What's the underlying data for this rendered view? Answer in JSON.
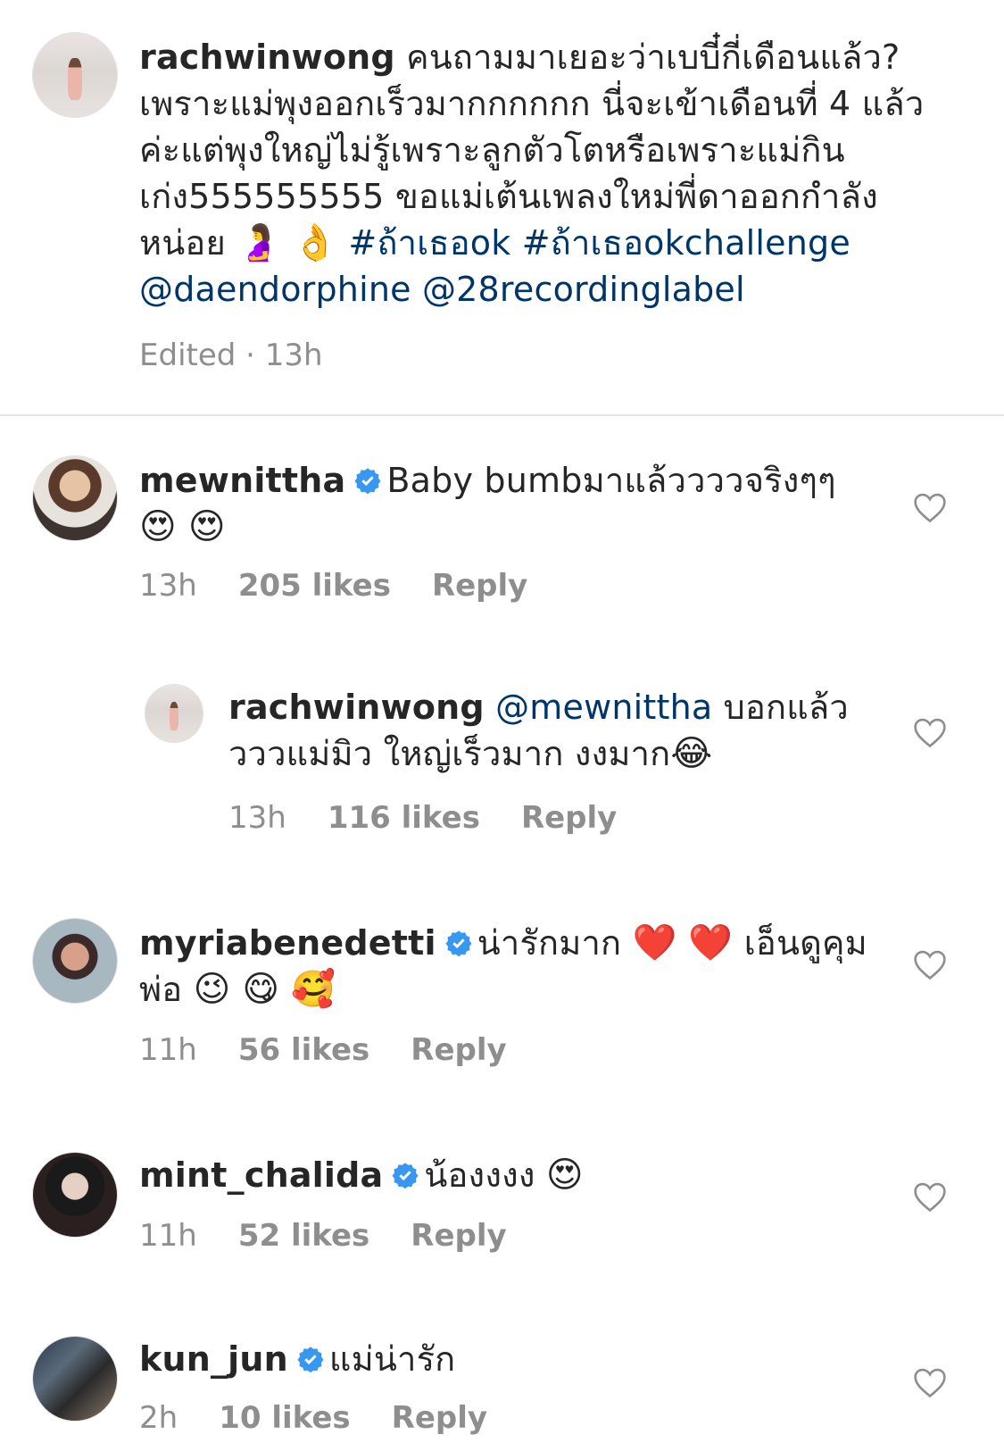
{
  "caption": {
    "username": "rachwinwong",
    "text": "คนถามมาเยอะว่าเบบี๋กี่เดือนแล้ว? เพราะแม่พุงออกเร็วมากกกกกก นี่จะเข้าเดือนที่ 4 แล้วค่ะแต่พุงใหญ่ไม่รู้เพราะลูกตัวโตหรือเพราะแม่กินเก่ง555555555 ขอแม่เต้นเพลงใหม่พี่ดาออกกำลังหน่อย",
    "emoji": "🤰 👌",
    "hashtags": "#ถ้าเธอok #ถ้าเธอokchallenge",
    "mentions": "@daendorphine @28recordinglabel",
    "edited": "Edited · 13h"
  },
  "comments": [
    {
      "username": "mewnittha",
      "text": "Baby bumbมาแล้ววววจริงๆๆ",
      "emoji": "😍 😍",
      "time": "13h",
      "likes": "205 likes",
      "reply": "Reply"
    },
    {
      "username": "rachwinwong",
      "mention": "@mewnittha",
      "text": "บอกแล้ววววแม่มิว ใหญ่เร็วมาก งงมาก",
      "emoji": "😂",
      "time": "13h",
      "likes": "116 likes",
      "reply": "Reply"
    },
    {
      "username": "myriabenedetti",
      "text": "น่ารักมาก",
      "emoji_a": "❤️ ❤️",
      "text2": "เอ็นดูคุมพ่อ",
      "emoji_b": "😉 😋 🥰",
      "time": "11h",
      "likes": "56 likes",
      "reply": "Reply"
    },
    {
      "username": "mint_chalida",
      "text": "น้องงงง",
      "emoji": "😍",
      "time": "11h",
      "likes": "52 likes",
      "reply": "Reply"
    },
    {
      "username": "kun_jun",
      "text": "แม่น่ารัก",
      "time": "2h",
      "likes": "10 likes",
      "reply": "Reply"
    }
  ],
  "colors": {
    "link": "#003569",
    "verified": "#3897f0",
    "meta": "#8e8e8e"
  }
}
